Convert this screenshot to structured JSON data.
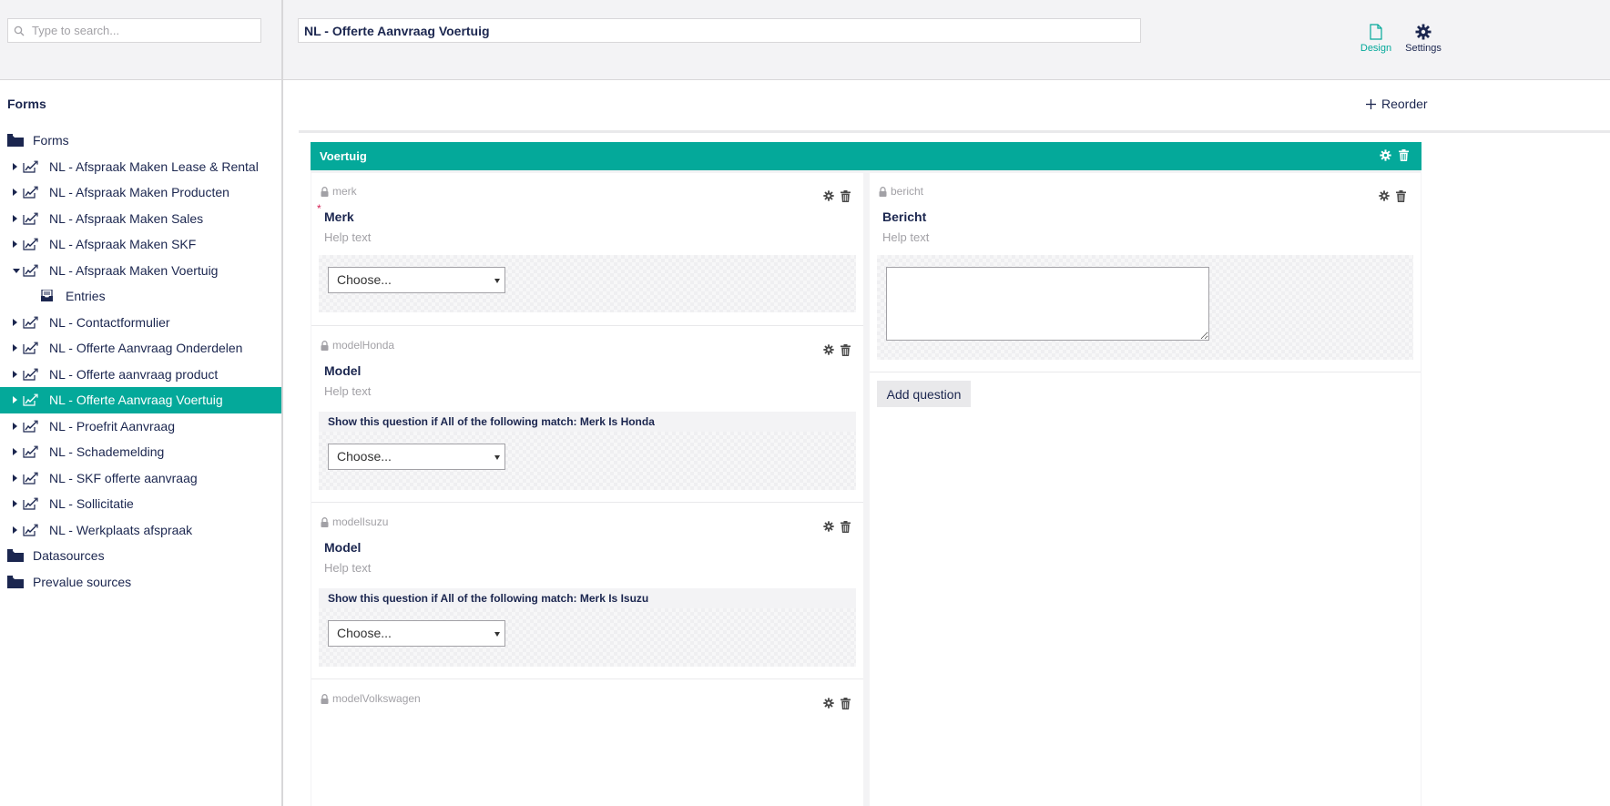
{
  "search": {
    "placeholder": "Type to search..."
  },
  "tree": {
    "heading": "Forms",
    "items": [
      {
        "label": "Forms",
        "level": 0,
        "icon": "folder-icon",
        "caret": "none",
        "active": false
      },
      {
        "label": "NL - Afspraak Maken Lease & Rental",
        "level": 1,
        "icon": "form-icon",
        "caret": "right",
        "active": false
      },
      {
        "label": "NL - Afspraak Maken Producten",
        "level": 1,
        "icon": "form-icon",
        "caret": "right",
        "active": false
      },
      {
        "label": "NL - Afspraak Maken Sales",
        "level": 1,
        "icon": "form-icon",
        "caret": "right",
        "active": false
      },
      {
        "label": "NL - Afspraak Maken SKF",
        "level": 1,
        "icon": "form-icon",
        "caret": "right",
        "active": false
      },
      {
        "label": "NL - Afspraak Maken Voertuig",
        "level": 1,
        "icon": "form-icon",
        "caret": "down",
        "active": false
      },
      {
        "label": "Entries",
        "level": 2,
        "icon": "inbox-icon",
        "caret": "none",
        "active": false
      },
      {
        "label": "NL - Contactformulier",
        "level": 1,
        "icon": "form-icon",
        "caret": "right",
        "active": false
      },
      {
        "label": "NL - Offerte Aanvraag Onderdelen",
        "level": 1,
        "icon": "form-icon",
        "caret": "right",
        "active": false
      },
      {
        "label": "NL - Offerte aanvraag product",
        "level": 1,
        "icon": "form-icon",
        "caret": "right",
        "active": false
      },
      {
        "label": "NL - Offerte Aanvraag Voertuig",
        "level": 1,
        "icon": "form-icon",
        "caret": "right",
        "active": true
      },
      {
        "label": "NL - Proefrit Aanvraag",
        "level": 1,
        "icon": "form-icon",
        "caret": "right",
        "active": false
      },
      {
        "label": "NL - Schademelding",
        "level": 1,
        "icon": "form-icon",
        "caret": "right",
        "active": false
      },
      {
        "label": "NL - SKF offerte aanvraag",
        "level": 1,
        "icon": "form-icon",
        "caret": "right",
        "active": false
      },
      {
        "label": "NL - Sollicitatie",
        "level": 1,
        "icon": "form-icon",
        "caret": "right",
        "active": false
      },
      {
        "label": "NL - Werkplaats afspraak",
        "level": 1,
        "icon": "form-icon",
        "caret": "right",
        "active": false
      },
      {
        "label": "Datasources",
        "level": 0,
        "icon": "folder-icon",
        "caret": "none",
        "active": false
      },
      {
        "label": "Prevalue sources",
        "level": 0,
        "icon": "folder-icon",
        "caret": "none",
        "active": false
      }
    ]
  },
  "header": {
    "form_name": "NL - Offerte Aanvraag Voertuig",
    "design_label": "Design",
    "settings_label": "Settings"
  },
  "main": {
    "reorder_label": "Reorder",
    "fieldset_title": "Voertuig",
    "add_question_label": "Add question",
    "left_questions": [
      {
        "alias": "merk",
        "caption": "Merk",
        "help": "Help text",
        "required_mark": "*",
        "condition": "",
        "select_value": "Choose..."
      },
      {
        "alias": "modelHonda",
        "caption": "Model",
        "help": "Help text",
        "condition": "Show this question if All of the following match: Merk Is Honda",
        "select_value": "Choose..."
      },
      {
        "alias": "modelIsuzu",
        "caption": "Model",
        "help": "Help text",
        "condition": "Show this question if All of the following match: Merk Is Isuzu",
        "select_value": "Choose..."
      },
      {
        "alias": "modelVolkswagen"
      }
    ],
    "right_questions": [
      {
        "alias": "bericht",
        "caption": "Bericht",
        "help": "Help text"
      }
    ]
  },
  "colors": {
    "accent": "#04a99a",
    "text": "#1b264f",
    "muted": "#a2a1a6",
    "panel": "#f3f3f5"
  }
}
